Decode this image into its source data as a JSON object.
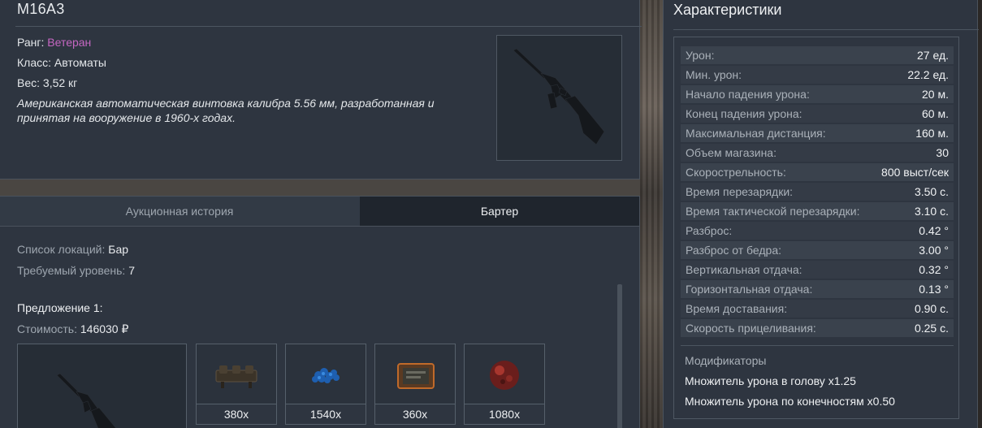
{
  "item": {
    "name": "M16A3",
    "rank_label": "Ранг:",
    "rank_value": "Ветеран",
    "class_line": "Класс: Автоматы",
    "weight_line": "Вес: 3,52 кг",
    "description": "Американская автоматическая винтовка калибра 5.56 мм, разработанная и принятая на вооружение в 1960-х годах.",
    "image_icon": "rifle-image"
  },
  "tabs": [
    {
      "label": "Аукционная история",
      "active": false
    },
    {
      "label": "Бартер",
      "active": true
    }
  ],
  "barter": {
    "locations_label": "Список локаций:",
    "locations_value": "Бар",
    "level_label": "Требуемый уровень:",
    "level_value": "7",
    "offer_title": "Предложение 1:",
    "cost_label": "Стоимость:",
    "cost_value": "146030 ₽",
    "result_icon": "rifle-image",
    "ingredients": [
      {
        "icon": "device-box-icon",
        "qty": "380x"
      },
      {
        "icon": "blue-crystals-icon",
        "qty": "1540x"
      },
      {
        "icon": "tablet-device-icon",
        "qty": "360x"
      },
      {
        "icon": "red-sphere-icon",
        "qty": "1080x"
      }
    ]
  },
  "stats": {
    "title": "Характеристики",
    "rows": [
      {
        "label": "Урон:",
        "value": "27 ед."
      },
      {
        "label": "Мин. урон:",
        "value": "22.2 ед."
      },
      {
        "label": "Начало падения урона:",
        "value": "20 м."
      },
      {
        "label": "Конец падения урона:",
        "value": "60 м."
      },
      {
        "label": "Максимальная дистанция:",
        "value": "160 м."
      },
      {
        "label": "Объем магазина:",
        "value": "30"
      },
      {
        "label": "Скорострельность:",
        "value": "800 выст/сек"
      },
      {
        "label": "Время перезарядки:",
        "value": "3.50 с."
      },
      {
        "label": "Время тактической перезарядки:",
        "value": "3.10 с."
      },
      {
        "label": "Разброс:",
        "value": "0.42 °"
      },
      {
        "label": "Разброс от бедра:",
        "value": "3.00 °"
      },
      {
        "label": "Вертикальная отдача:",
        "value": "0.32 °"
      },
      {
        "label": "Горизонтальная отдача:",
        "value": "0.13 °"
      },
      {
        "label": "Время доставания:",
        "value": "0.90 с."
      },
      {
        "label": "Скорость прицеливания:",
        "value": "0.25 с."
      }
    ],
    "modifiers_title": "Модификаторы",
    "modifiers": [
      "Множитель урона в голову x1.25",
      "Множитель урона по конечностям x0.50"
    ]
  },
  "colors": {
    "panel": "#2e3540",
    "rank": "#c567c2",
    "active_tab": "#1f252d"
  }
}
